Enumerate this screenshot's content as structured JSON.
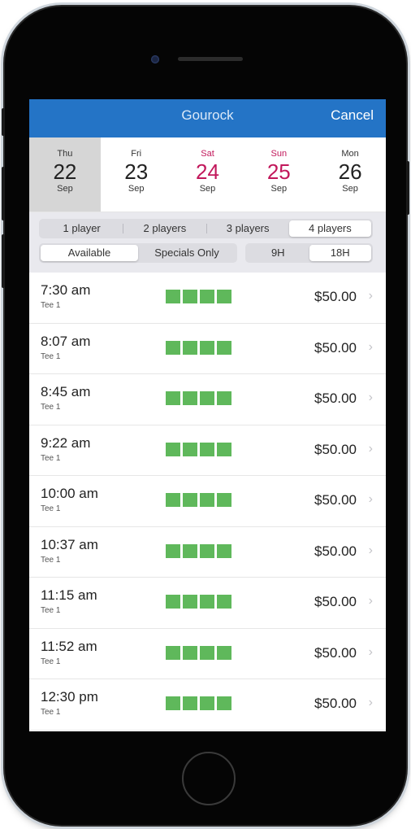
{
  "header": {
    "title": "Gourock",
    "cancel_label": "Cancel"
  },
  "dates": [
    {
      "dow": "Thu",
      "day": "22",
      "month": "Sep",
      "selected": true,
      "weekend": false
    },
    {
      "dow": "Fri",
      "day": "23",
      "month": "Sep",
      "selected": false,
      "weekend": false
    },
    {
      "dow": "Sat",
      "day": "24",
      "month": "Sep",
      "selected": false,
      "weekend": true
    },
    {
      "dow": "Sun",
      "day": "25",
      "month": "Sep",
      "selected": false,
      "weekend": true
    },
    {
      "dow": "Mon",
      "day": "26",
      "month": "Sep",
      "selected": false,
      "weekend": false
    }
  ],
  "players": {
    "options": [
      "1 player",
      "2 players",
      "3 players",
      "4 players"
    ],
    "selected": "4 players"
  },
  "availability": {
    "options": [
      "Available",
      "Specials Only"
    ],
    "selected": "Available"
  },
  "holes": {
    "options": [
      "9H",
      "18H"
    ],
    "selected": "18H"
  },
  "colors": {
    "nav": "#2474c6",
    "weekend": "#c2185b",
    "slot_available": "#5fb85b"
  },
  "tee_times": [
    {
      "time": "7:30 am",
      "tee": "Tee 1",
      "price": "$50.00",
      "slots_available": 4
    },
    {
      "time": "8:07 am",
      "tee": "Tee 1",
      "price": "$50.00",
      "slots_available": 4
    },
    {
      "time": "8:45 am",
      "tee": "Tee 1",
      "price": "$50.00",
      "slots_available": 4
    },
    {
      "time": "9:22 am",
      "tee": "Tee 1",
      "price": "$50.00",
      "slots_available": 4
    },
    {
      "time": "10:00 am",
      "tee": "Tee 1",
      "price": "$50.00",
      "slots_available": 4
    },
    {
      "time": "10:37 am",
      "tee": "Tee 1",
      "price": "$50.00",
      "slots_available": 4
    },
    {
      "time": "11:15 am",
      "tee": "Tee 1",
      "price": "$50.00",
      "slots_available": 4
    },
    {
      "time": "11:52 am",
      "tee": "Tee 1",
      "price": "$50.00",
      "slots_available": 4
    },
    {
      "time": "12:30 pm",
      "tee": "Tee 1",
      "price": "$50.00",
      "slots_available": 4
    }
  ]
}
